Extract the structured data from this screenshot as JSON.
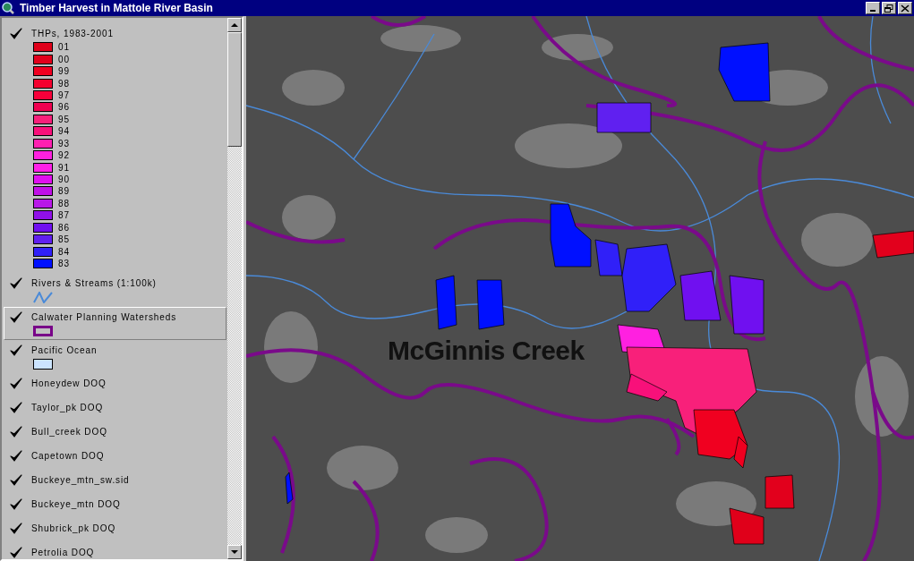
{
  "window": {
    "title": "Timber Harvest in Mattole River Basin"
  },
  "legend": {
    "layers": [
      {
        "kind": "classes",
        "name": "THPs, 1983-2001",
        "checked": true,
        "selected": false,
        "classes": [
          {
            "label": "01",
            "color": "#e0001a"
          },
          {
            "label": "00",
            "color": "#e2001c"
          },
          {
            "label": "99",
            "color": "#f00020"
          },
          {
            "label": "98",
            "color": "#f5002e"
          },
          {
            "label": "97",
            "color": "#f8003a"
          },
          {
            "label": "96",
            "color": "#f00050"
          },
          {
            "label": "95",
            "color": "#f8207a"
          },
          {
            "label": "94",
            "color": "#f8107a"
          },
          {
            "label": "93",
            "color": "#ff20b0"
          },
          {
            "label": "92",
            "color": "#ff20e0"
          },
          {
            "label": "91",
            "color": "#ff20e8"
          },
          {
            "label": "90",
            "color": "#e010f0"
          },
          {
            "label": "89",
            "color": "#c010e8"
          },
          {
            "label": "88",
            "color": "#b818e8"
          },
          {
            "label": "87",
            "color": "#9010e8"
          },
          {
            "label": "86",
            "color": "#7010f0"
          },
          {
            "label": "85",
            "color": "#6020f0"
          },
          {
            "label": "84",
            "color": "#3020f8"
          },
          {
            "label": "83",
            "color": "#0010ff"
          }
        ]
      },
      {
        "kind": "line",
        "name": "Rivers & Streams (1:100k)",
        "checked": true,
        "selected": false,
        "color": "#4a8ad8"
      },
      {
        "kind": "outline",
        "name": "Calwater Planning Watersheds",
        "checked": true,
        "selected": true,
        "color": "#780088"
      },
      {
        "kind": "fill",
        "name": "Pacific Ocean",
        "checked": true,
        "selected": false,
        "color": "#cce4ff"
      },
      {
        "kind": "image",
        "name": "Honeydew DOQ",
        "checked": true,
        "selected": false
      },
      {
        "kind": "image",
        "name": "Taylor_pk DOQ",
        "checked": true,
        "selected": false
      },
      {
        "kind": "image",
        "name": "Bull_creek DOQ",
        "checked": true,
        "selected": false
      },
      {
        "kind": "image",
        "name": "Capetown DOQ",
        "checked": true,
        "selected": false
      },
      {
        "kind": "image",
        "name": "Buckeye_mtn_sw.sid",
        "checked": true,
        "selected": false
      },
      {
        "kind": "image",
        "name": "Buckeye_mtn DOQ",
        "checked": true,
        "selected": false
      },
      {
        "kind": "image",
        "name": "Shubrick_pk DOQ",
        "checked": true,
        "selected": false
      },
      {
        "kind": "image",
        "name": "Petrolia DOQ",
        "checked": true,
        "selected": false
      }
    ]
  },
  "map": {
    "label": "McGinnis Creek"
  }
}
